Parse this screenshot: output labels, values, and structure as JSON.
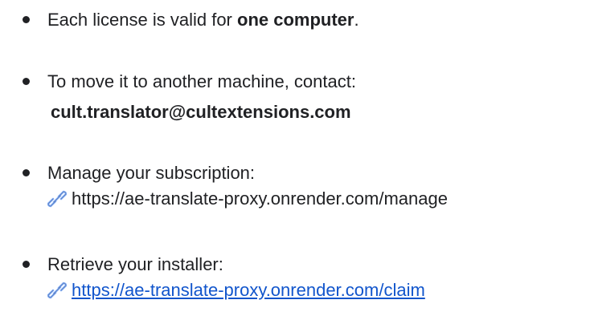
{
  "items": [
    {
      "text_before": "Each license is valid for ",
      "text_bold": "one computer",
      "text_after": "."
    },
    {
      "text": "To move it to another machine, contact:",
      "email": "cult.translator@cultextensions.com"
    },
    {
      "text": "Manage your subscription:",
      "link_icon": "link-icon",
      "url": "https://ae-translate-proxy.onrender.com/manage"
    },
    {
      "text": "Retrieve your installer:",
      "link_icon": "link-icon",
      "url": "https://ae-translate-proxy.onrender.com/claim"
    }
  ],
  "colors": {
    "text": "#202124",
    "link": "#1155cc",
    "icon": "#8ab4f8"
  }
}
